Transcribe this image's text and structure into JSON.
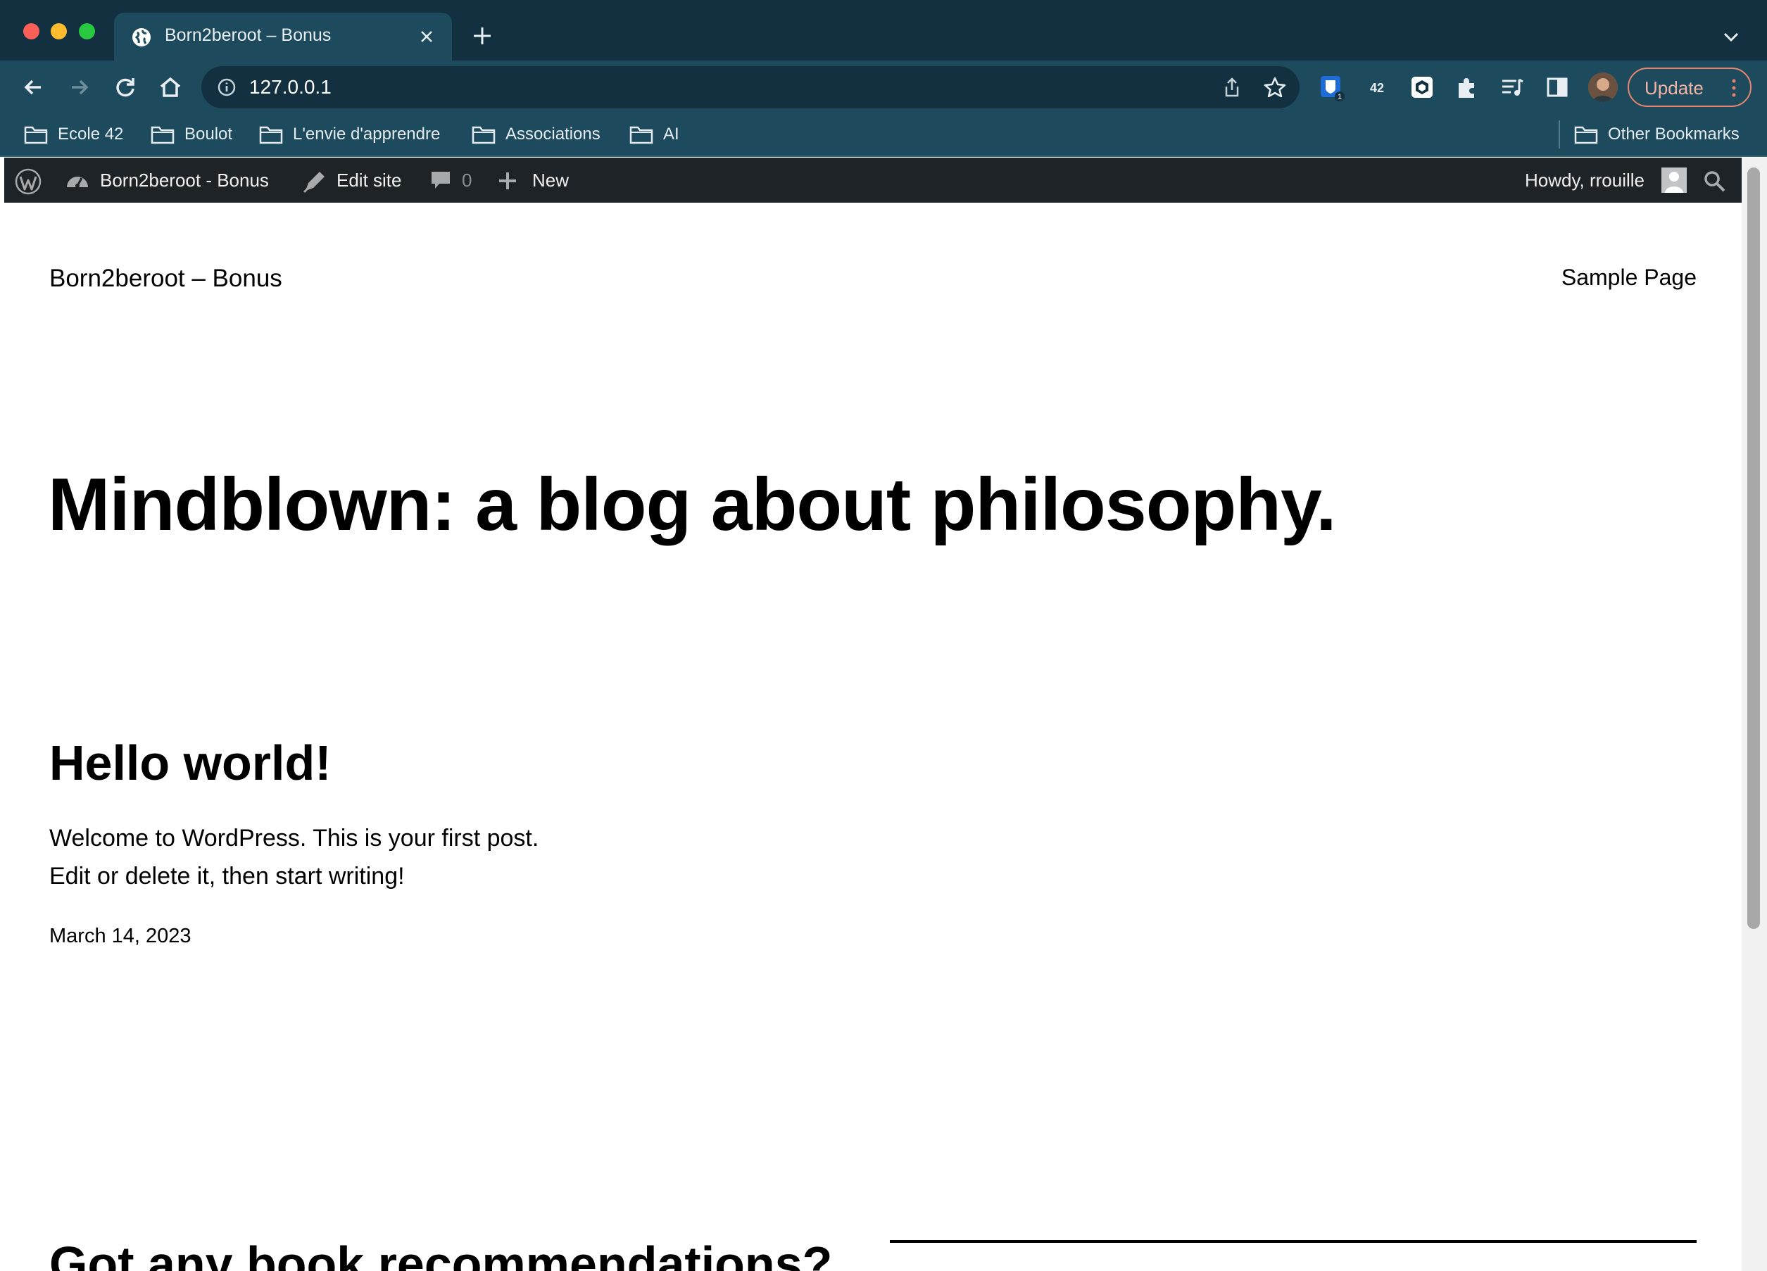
{
  "browser": {
    "tab": {
      "title": "Born2beroot – Bonus"
    },
    "omnibox": {
      "url": "127.0.0.1"
    },
    "update_label": "Update",
    "bookmarks": [
      {
        "label": "Ecole 42"
      },
      {
        "label": "Boulot"
      },
      {
        "label": "L'envie d'apprendre"
      },
      {
        "label": "Associations"
      },
      {
        "label": "AI"
      }
    ],
    "other_bookmarks": "Other Bookmarks",
    "extension_badge": "1",
    "colors": {
      "frame": "#123040",
      "toolbar": "#1d4a5c",
      "update_border": "#e8856e"
    }
  },
  "adminbar": {
    "site_name": "Born2beroot - Bonus",
    "edit_site": "Edit site",
    "comments_count": "0",
    "new_label": "New",
    "howdy": "Howdy, rrouille",
    "icons": [
      "wordpress-logo-icon",
      "dashboard-icon",
      "edit-site-icon",
      "comment-icon",
      "plus-icon",
      "user-avatar-icon",
      "search-icon"
    ]
  },
  "site": {
    "title": "Born2beroot – Bonus",
    "nav": [
      "Sample Page"
    ],
    "hero": "Mindblown: a blog about philosophy."
  },
  "post": {
    "title": "Hello world!",
    "excerpt_line_1": "Welcome to WordPress. This is your first post.",
    "excerpt_line_2": "Edit or delete it, then start writing!",
    "date": "March 14, 2023"
  },
  "next_section": {
    "heading": "Got any book recommendations?"
  }
}
